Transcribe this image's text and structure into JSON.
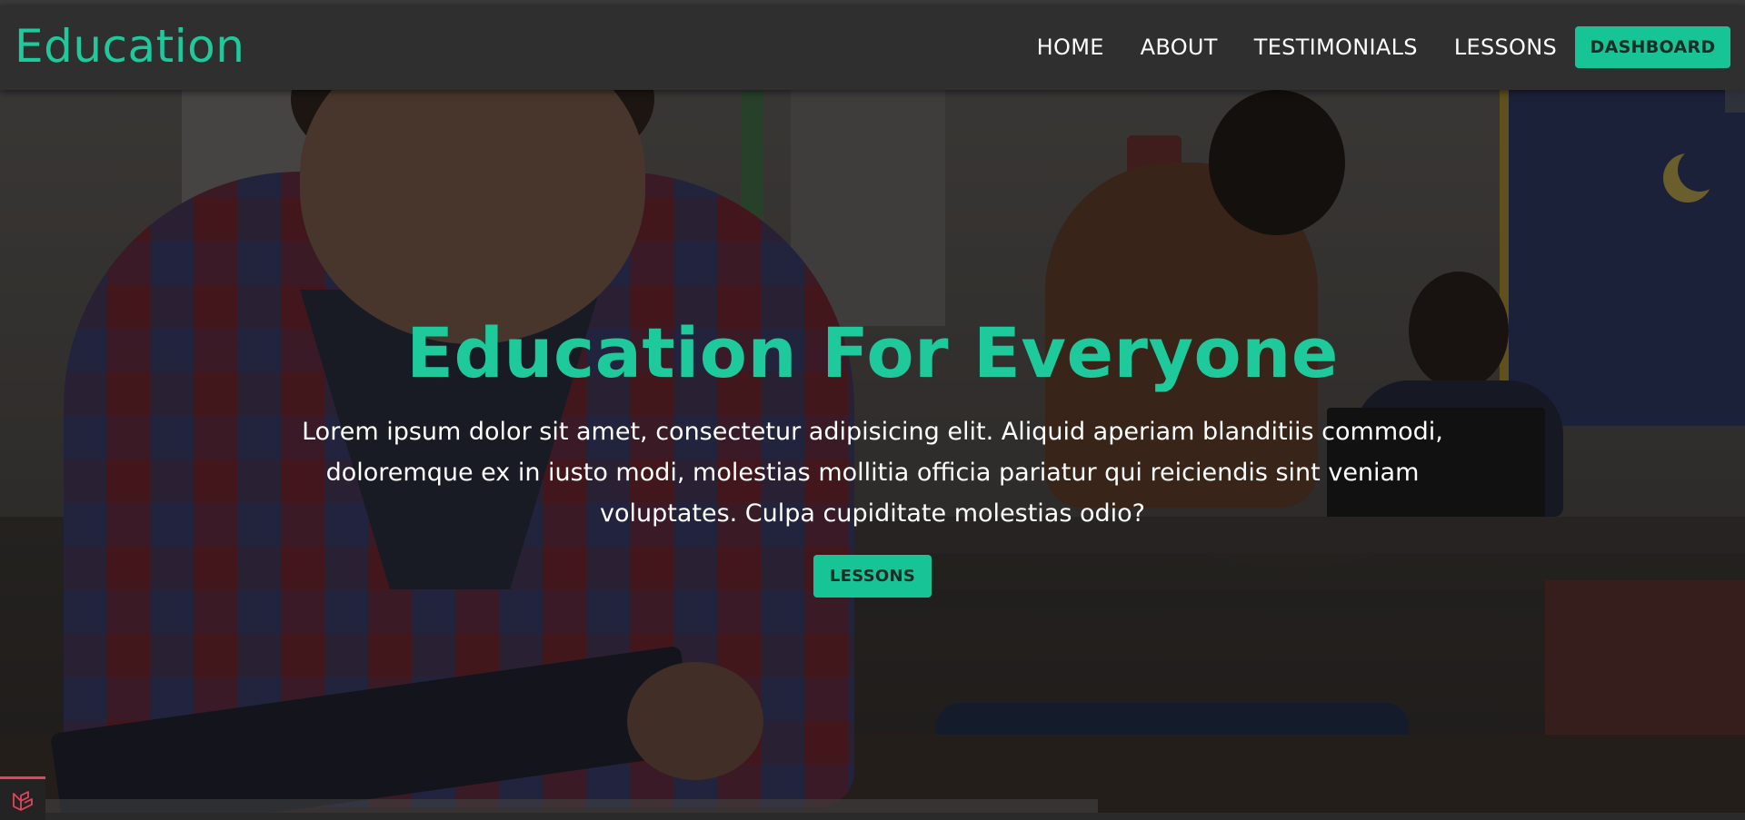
{
  "navbar": {
    "brand": "Education",
    "links": [
      {
        "label": "HOME"
      },
      {
        "label": "ABOUT"
      },
      {
        "label": "TESTIMONIALS"
      },
      {
        "label": "LESSONS"
      }
    ],
    "dashboard_label": "DASHBOARD"
  },
  "hero": {
    "title": "Education For Everyone",
    "description": "Lorem ipsum dolor sit amet, consectetur adipisicing elit. Aliquid aperiam blanditiis commodi, doloremque ex in iusto modi, molestias mollitia officia pariatur qui reiciendis sint veniam voluptates. Culpa cupiditate molestias odio?",
    "cta_label": "LESSONS"
  },
  "colors": {
    "accent": "#1ec99c",
    "button": "#16c495",
    "navbar_bg": "#2f2f2f",
    "text": "#ffffff"
  },
  "icons": {
    "debug_badge": "laravel-icon"
  }
}
